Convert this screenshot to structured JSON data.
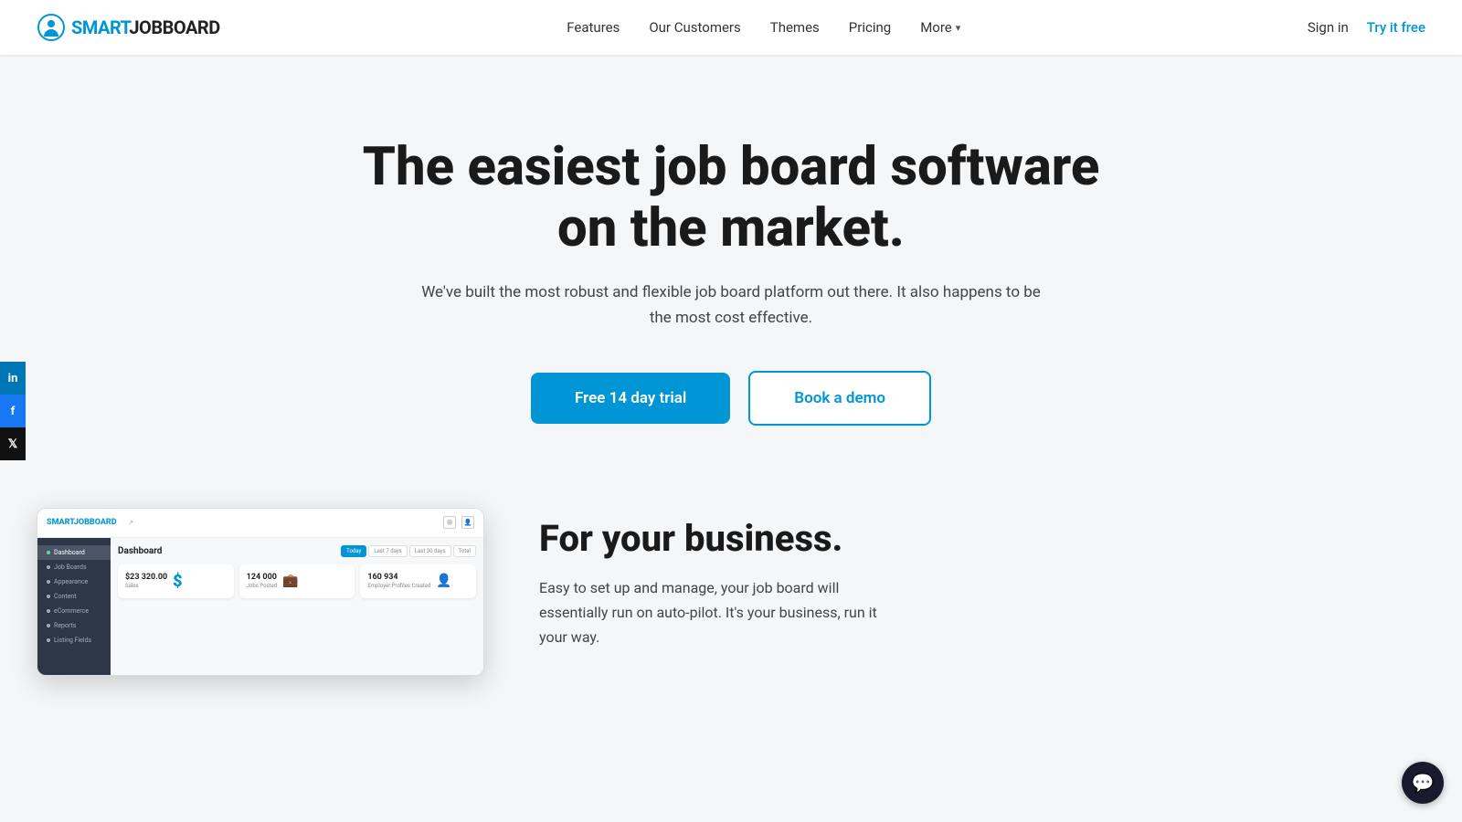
{
  "header": {
    "logo": {
      "smart": "SMART",
      "jobboard": "JOBBOARD"
    },
    "nav": [
      {
        "label": "Features",
        "has_dropdown": false
      },
      {
        "label": "Our Customers",
        "has_dropdown": false
      },
      {
        "label": "Themes",
        "has_dropdown": false
      },
      {
        "label": "Pricing",
        "has_dropdown": false
      },
      {
        "label": "More",
        "has_dropdown": true
      }
    ],
    "sign_in": "Sign in",
    "try_free": "Try it free"
  },
  "social": [
    {
      "name": "linkedin",
      "label": "in"
    },
    {
      "name": "facebook",
      "label": "f"
    },
    {
      "name": "twitter",
      "label": "𝕏"
    }
  ],
  "hero": {
    "title": "The easiest job board software on the market.",
    "subtitle": "We've built the most robust and flexible job board platform out there. It also happens to be the most cost effective.",
    "cta_primary": "Free 14 day trial",
    "cta_secondary": "Book a demo"
  },
  "dashboard": {
    "logo_smart": "SMART",
    "logo_job": "JOBBOARD",
    "title": "Dashboard",
    "tabs": [
      "Today",
      "Last 7 days",
      "Last 30 days",
      "Total"
    ],
    "stats": [
      {
        "value": "$23 320.00",
        "icon": "$",
        "icon_type": "blue",
        "label": "Sales"
      },
      {
        "value": "124 000",
        "icon": "💼",
        "icon_type": "green",
        "label": "Jobs Posted"
      },
      {
        "value": "160 934",
        "icon": "👤",
        "icon_type": "red",
        "label": "Employer Profiles Created"
      }
    ],
    "sidebar_items": [
      {
        "label": "Dashboard",
        "active": true
      },
      {
        "label": "Job Boards",
        "active": false
      },
      {
        "label": "Appearance",
        "active": false
      },
      {
        "label": "Content",
        "active": false
      },
      {
        "label": "eCommerce",
        "active": false
      },
      {
        "label": "Reports",
        "active": false
      },
      {
        "label": "Listing Fields",
        "active": false
      }
    ]
  },
  "business": {
    "title": "For your business.",
    "description": "Easy to set up and manage, your job board will essentially run on auto-pilot. It's your business, run it your way."
  },
  "colors": {
    "primary": "#0096d6",
    "dark": "#1a1a1a",
    "text_muted": "#444"
  }
}
